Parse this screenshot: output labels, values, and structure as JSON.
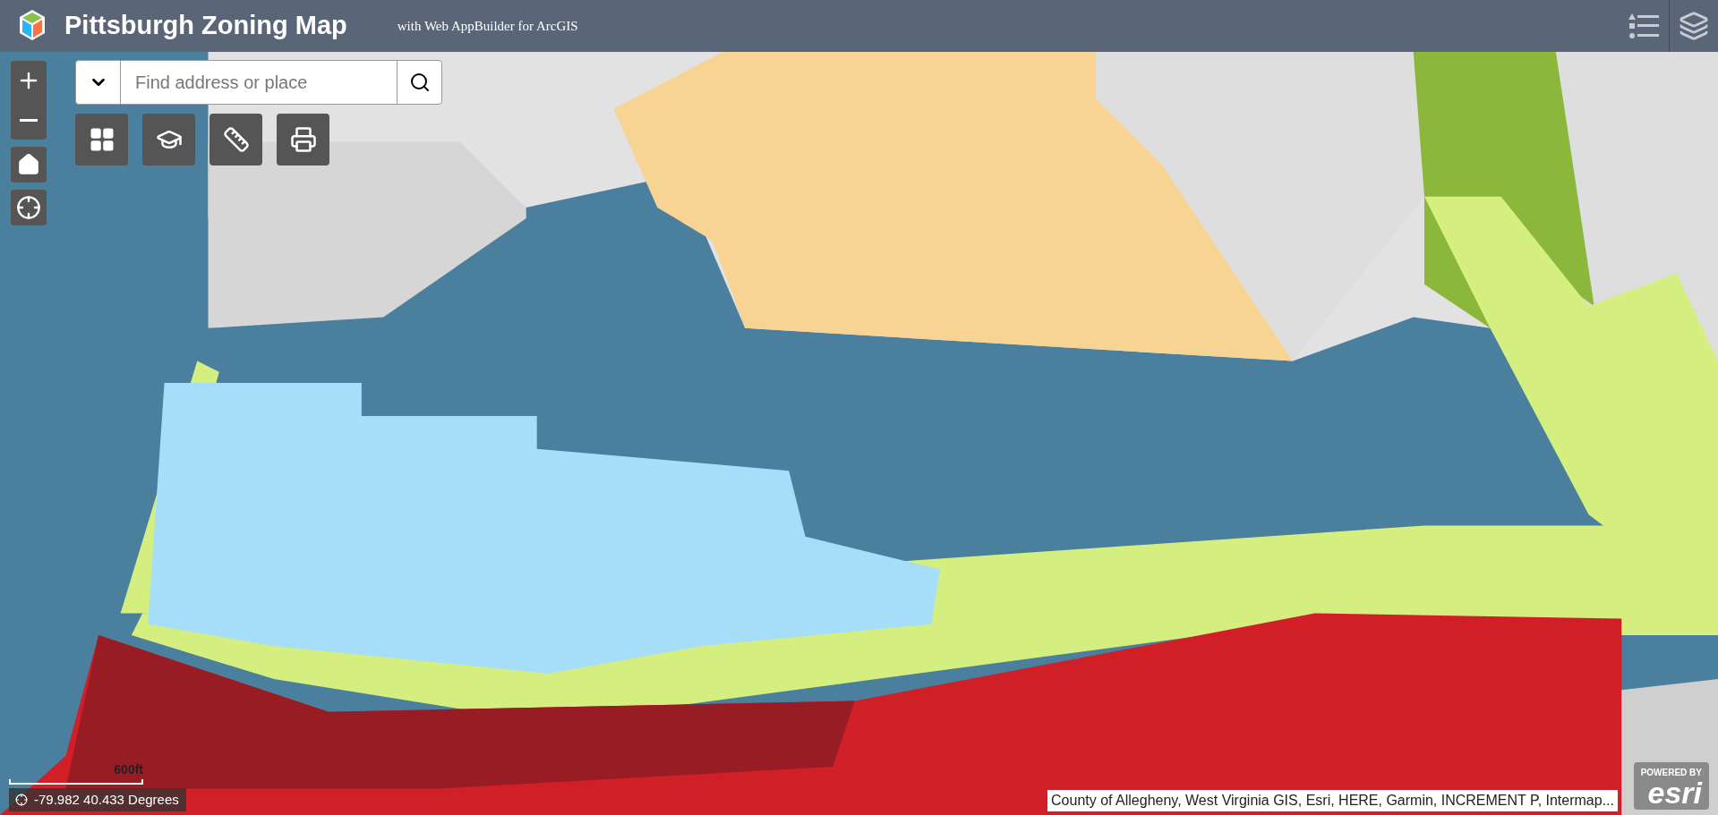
{
  "header": {
    "title": "Pittsburgh Zoning Map",
    "subtitle": "with Web AppBuilder for ArcGIS"
  },
  "search": {
    "placeholder": "Find address or place"
  },
  "scale_bar": {
    "label": "600ft"
  },
  "coordinates": {
    "reading": "-79.982 40.433 Degrees"
  },
  "attribution": "County of Allegheny, West Virginia GIS, Esri, HERE, Garmin, INCREMENT P, Intermap...",
  "logo": {
    "caption": "POWERED BY",
    "wordmark": "esri"
  }
}
